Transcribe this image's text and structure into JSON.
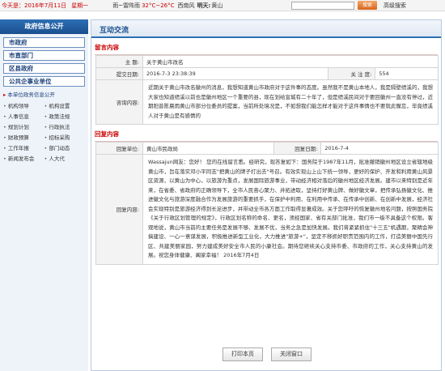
{
  "topbar": {
    "date": "今天是：2016年7月11日",
    "weekday": "星期一",
    "weather": "雨~雷阵雨",
    "temp": "32°C~26°C",
    "wind": "西南风",
    "tomorrow_label": "明天:",
    "tomorrow_value": "黄山",
    "search_button": "搜索",
    "advanced_search": "高级搜索"
  },
  "sidebar": {
    "title": "政府信息公开",
    "categories": [
      "市政府",
      "市直部门",
      "区县政府",
      "公共企事业单位"
    ],
    "sub_heading": "本单位政务信息公开",
    "links": [
      "机构领导",
      "机构设置",
      "人事信息",
      "政策法规",
      "规划计划",
      "行政执法",
      "财政预算",
      "招标采购",
      "工作年报",
      "部门动态",
      "新闻发布会",
      "人大代"
    ]
  },
  "main": {
    "tab": "互动交流",
    "message_section": "留言内容",
    "subject_label": "主      题:",
    "subject_value": "关于黄山市改名",
    "submit_date_label": "提交日期:",
    "submit_date_value": "2016-7-3 23:38:39",
    "attention_label": "关 注 度:",
    "attention_value": "554",
    "inquiry_label": "咨询内容:",
    "inquiry_text": "近期关于黄山市改名徽州的消息，我想知道黄山市政府对于这件事的态度。虽然我不是黄山本地人，我是隔壁绩溪的，我想大家也知道绩溪以前也是徽州地区一个重要的县，现在划给宣城有二十年了，但是绩溪民间对于要回徽州一直没有停过，近期阳普陈晨雨黄山市部分位委员的提案，当前所处境况是，不如想我们能怎样才能对于这件事情也不要就此懈怠，毕竟绩溪人对于黄山是有感情的",
    "reply_section": "回复内容",
    "reply_unit_label": "回复单位:",
    "reply_unit_value": "黄山市民政局",
    "reply_date_label": "回复日期:",
    "reply_date_value": "2016-7-4",
    "reply_content_label": "回复内容:",
    "reply_text": "Wassajun网友：您好！ 您的在线留言悉。经研究，现答复如下：国务院于1987年11月，批准撤销徽州地区设立省辖地级黄山市，旨在落实邓小平同志\"把黄山的牌子打出去\"号召。有效实现山上山下统一领导，更好的保护、开发和利用黄山风景区资源，以黄山为中心，以旅游为重点，发展国际旅游事业，带动经济相对落后的徽州地区经济发展。建市以来特别是近年来，在省委、省政府的正确领导下，全市人民奋心聚力、并拓进取，坚持打好黄山牌、做好徽文章，把传承弘扬徽文化、推进徽文化与旅游深度融合作为发展旅游的重要抓手，在保护中利用、在利用中传承、在传承中创新、在创新中发展，经济社会实现特别是旅游经济得到长足进步，并带动全市各方面工作取得显著成效。关于您呼吁的恢复徽州地名问题，按照国务院《关于行政区划管理的规定》，行政区划名称的命名、更名，须经国家、省有关部门批准，我们市一级不具备这个权限。客观地说，黄山市当前的主要任务是发展不够、发展不优，当务之急是加快发展。我们将紧紧抓住\"十三五\"机遇期，聚精会神搞建设、一心一意谋发展，积极推进新型工业化，大力推进\"旅游+\"，坚定不移抓好职责范围内的工作，打造美丽中国先行区、共建美丽家园，努力建成美好安全市人民的小康社会。期待您继续关心支持市委、市政府的工作，关心支持黄山的发展。祝您身体健康、阖家幸福！ 2016年7月4日"
  },
  "buttons": {
    "print": "打印本页",
    "close": "关闭窗口"
  },
  "colors": {
    "accent_blue": "#2d6fb4",
    "section_red": "#cc0000",
    "search_orange": "#e07a2e"
  }
}
